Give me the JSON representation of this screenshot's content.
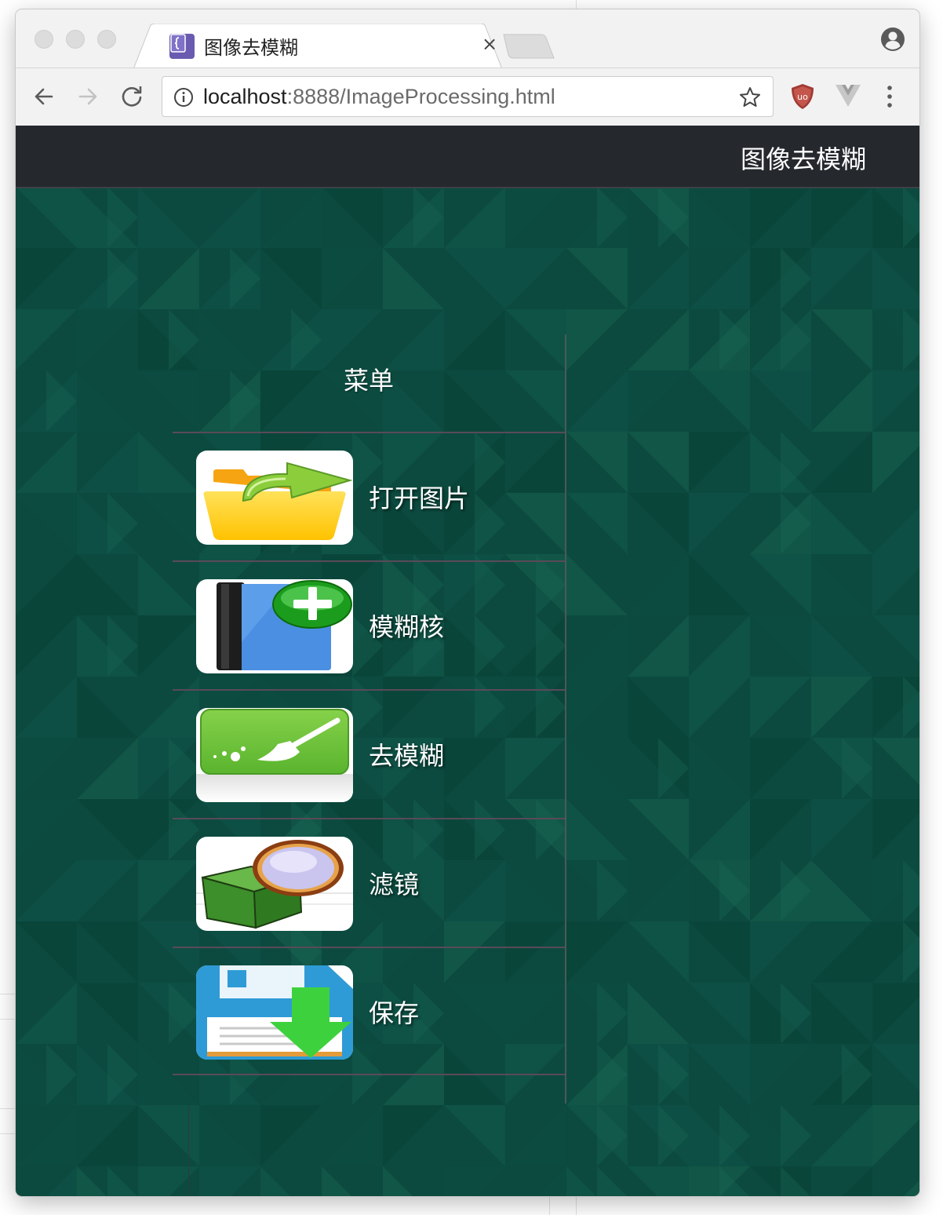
{
  "browser": {
    "tab": {
      "title": "图像去模糊",
      "close_glyph": "×",
      "favicon": "bracket-favicon-icon"
    },
    "address_bar": {
      "host": "localhost",
      "path": ":8888/ImageProcessing.html"
    },
    "icons": {
      "back": "back-arrow-icon",
      "forward": "forward-arrow-icon",
      "reload": "reload-icon",
      "info": "info-icon",
      "bookmark": "star-icon",
      "extension_1": "ublock-icon",
      "extension_2": "vue-devtools-icon",
      "menu": "kebab-menu-icon",
      "profile": "profile-icon"
    }
  },
  "navbar": {
    "brand": "图像去模糊"
  },
  "menu": {
    "title": "菜单",
    "items": [
      {
        "label": "打开图片",
        "icon": "open-folder-icon"
      },
      {
        "label": "模糊核",
        "icon": "add-book-icon"
      },
      {
        "label": "去模糊",
        "icon": "broom-icon"
      },
      {
        "label": "滤镜",
        "icon": "filter-magnifier-icon"
      },
      {
        "label": "保存",
        "icon": "save-download-icon"
      }
    ]
  },
  "colors": {
    "page_background": "#0c4a3f",
    "navbar_background": "#25282d",
    "divider": "#5a4a58"
  }
}
